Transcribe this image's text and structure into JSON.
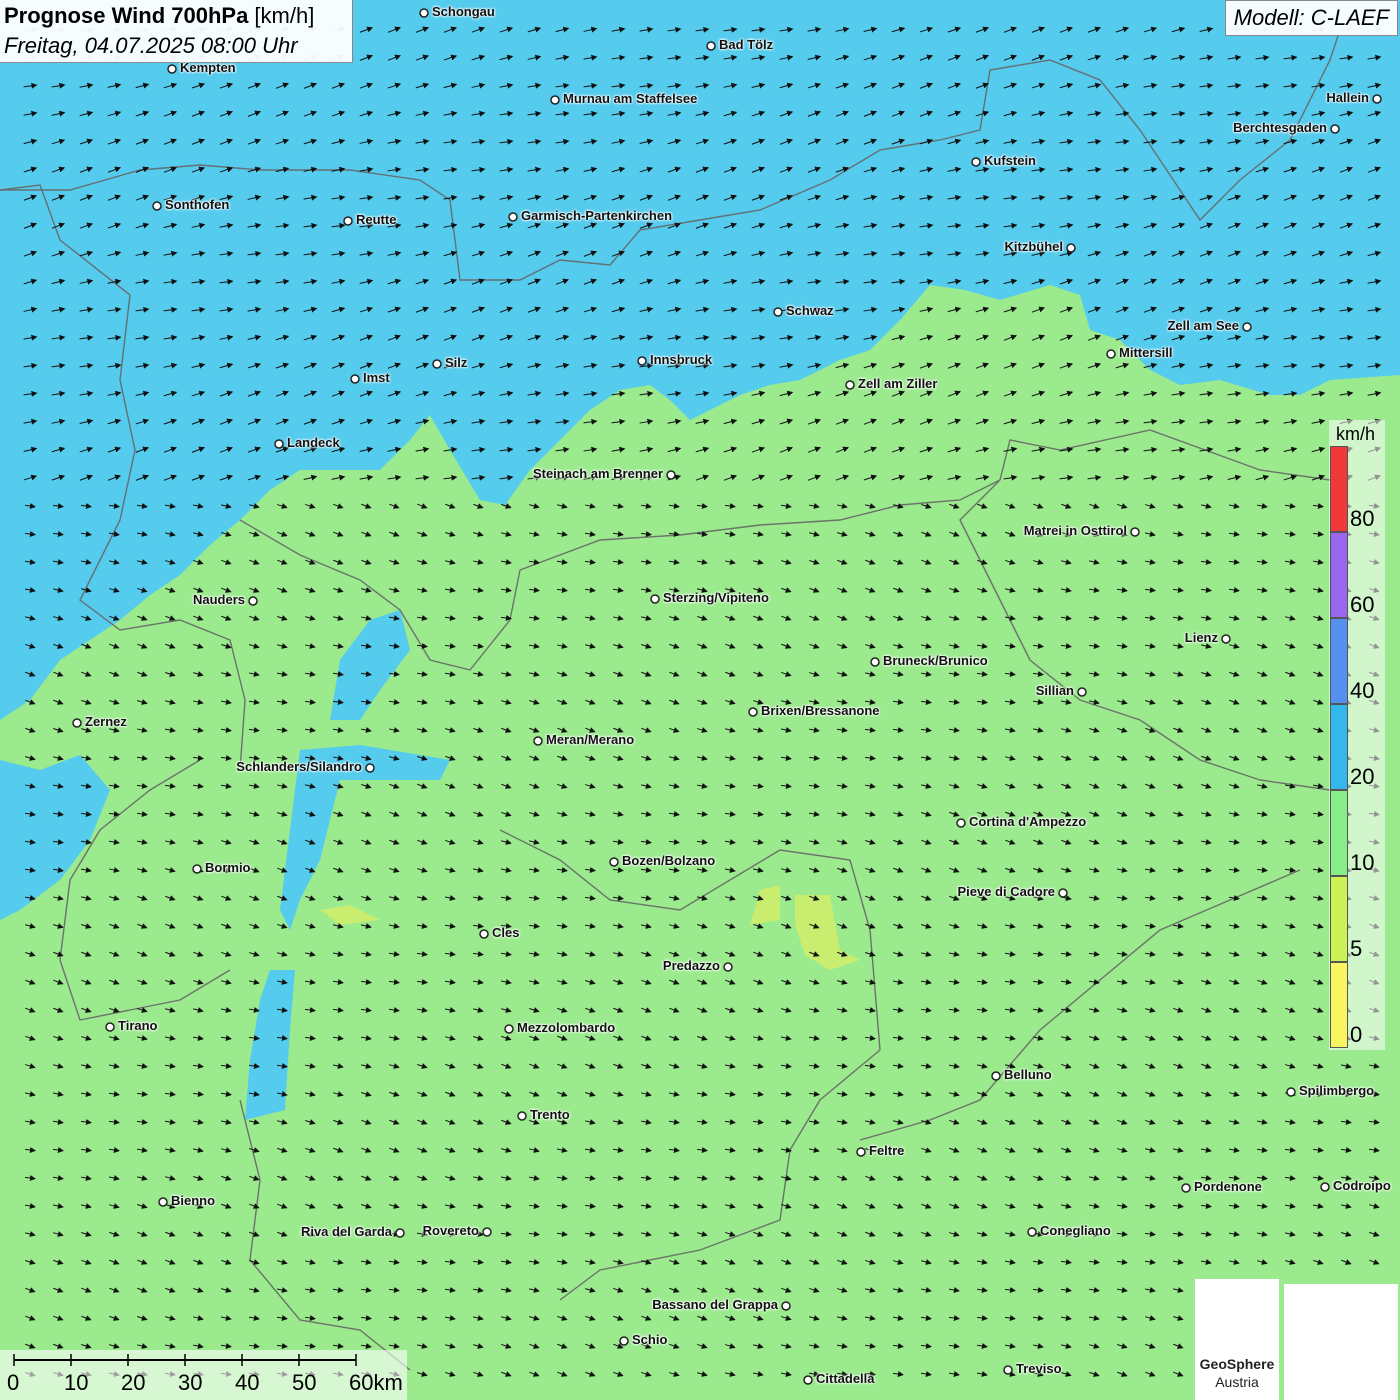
{
  "header": {
    "title_bold": "Prognose Wind 700hPa",
    "title_unit": " [km/h]",
    "subtitle": "Freitag, 04.07.2025 08:00 Uhr",
    "model": "Modell: C-LAEF"
  },
  "legend": {
    "unit": "km/h",
    "labels": [
      "80",
      "60",
      "40",
      "20",
      "10",
      "5",
      "0"
    ],
    "colors": [
      "#f03a3a",
      "#9966ee",
      "#5590ee",
      "#33b8ee",
      "#88ee88",
      "#ccf255",
      "#f8f560"
    ]
  },
  "scalebar": {
    "labels": [
      "0",
      "10",
      "20",
      "30",
      "40",
      "50",
      "60km"
    ]
  },
  "logo": {
    "name": "GeoSphere",
    "sub": "Austria"
  },
  "cities": [
    {
      "name": "Schongau"
    },
    {
      "name": "Bad Tölz"
    },
    {
      "name": "Kempten"
    },
    {
      "name": "Murnau am Staffelsee"
    },
    {
      "name": "Hallein"
    },
    {
      "name": "Berchtesgaden"
    },
    {
      "name": "Kufstein"
    },
    {
      "name": "Sonthofen"
    },
    {
      "name": "Reutte"
    },
    {
      "name": "Garmisch-Partenkirchen"
    },
    {
      "name": "Kitzbühel"
    },
    {
      "name": "Schwaz"
    },
    {
      "name": "Zell am See"
    },
    {
      "name": "Mittersill"
    },
    {
      "name": "Innsbruck"
    },
    {
      "name": "Silz"
    },
    {
      "name": "Imst"
    },
    {
      "name": "Zell am Ziller"
    },
    {
      "name": "Landeck"
    },
    {
      "name": "Steinach am Brenner"
    },
    {
      "name": "Matrei in Osttirol"
    },
    {
      "name": "Nauders"
    },
    {
      "name": "Sterzing/Vipiteno"
    },
    {
      "name": "Lienz"
    },
    {
      "name": "Bruneck/Brunico"
    },
    {
      "name": "Sillian"
    },
    {
      "name": "Brixen/Bressanone"
    },
    {
      "name": "Zernez"
    },
    {
      "name": "Meran/Merano"
    },
    {
      "name": "Schlanders/Silandro"
    },
    {
      "name": "Cortina d'Ampezzo"
    },
    {
      "name": "Bozen/Bolzano"
    },
    {
      "name": "Pieve di Cadore"
    },
    {
      "name": "Bormio"
    },
    {
      "name": "Cles"
    },
    {
      "name": "Predazzo"
    },
    {
      "name": "Tirano"
    },
    {
      "name": "Mezzolombardo"
    },
    {
      "name": "Belluno"
    },
    {
      "name": "Spilimbergo"
    },
    {
      "name": "Trento"
    },
    {
      "name": "Feltre"
    },
    {
      "name": "Pordenone"
    },
    {
      "name": "Codroipo"
    },
    {
      "name": "Bienno"
    },
    {
      "name": "Riva del Garda"
    },
    {
      "name": "Rovereto"
    },
    {
      "name": "Conegliano"
    },
    {
      "name": "Bassano del Grappa"
    },
    {
      "name": "Schio"
    },
    {
      "name": "Treviso"
    },
    {
      "name": "Cittadella"
    }
  ]
}
